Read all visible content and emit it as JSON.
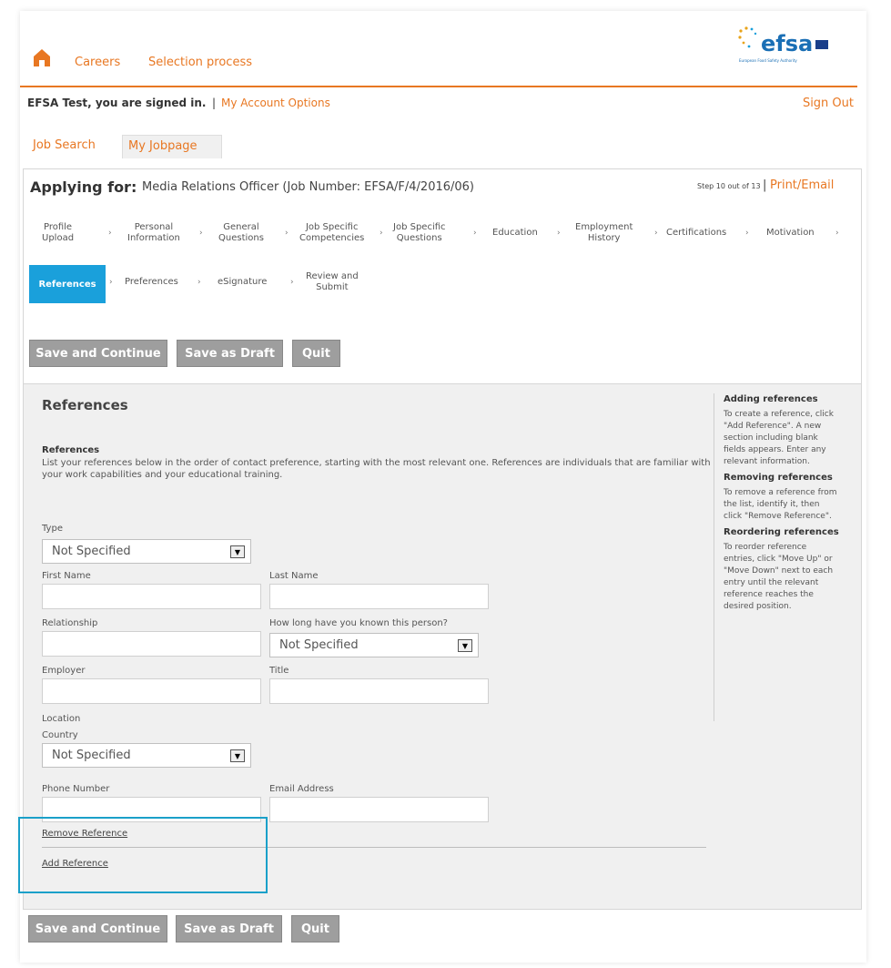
{
  "header": {
    "nav": [
      "Careers",
      "Selection process"
    ],
    "logo_text": "efsa",
    "logo_subtext": "European Food Safety Authority",
    "signed_in": "EFSA Test, you are signed in.",
    "separator": "|",
    "account_options": "My Account Options",
    "sign_out": "Sign Out"
  },
  "tabs": [
    "Job Search",
    "My Jobpage"
  ],
  "application": {
    "applying_for_label": "Applying for:",
    "job": "Media Relations Officer (Job Number: EFSA/F/4/2016/06)",
    "step": "Step 10 out of 13",
    "print_email": "Print/Email",
    "separator": "|"
  },
  "steps": [
    [
      "Profile",
      "Upload"
    ],
    [
      "Personal",
      "Information"
    ],
    [
      "General",
      "Questions"
    ],
    [
      "Job Specific",
      "Competencies"
    ],
    [
      "Job Specific",
      "Questions"
    ],
    [
      "Education"
    ],
    [
      "Employment",
      "History"
    ],
    [
      "Certifications"
    ],
    [
      "Motivation"
    ],
    [
      "References"
    ],
    [
      "Preferences"
    ],
    [
      "eSignature"
    ],
    [
      "Review and",
      "Submit"
    ]
  ],
  "step_sep": "›",
  "buttons": {
    "save_continue": "Save and Continue",
    "save_draft": "Save as Draft",
    "quit": "Quit"
  },
  "section": {
    "title": "References",
    "subtitle": "References",
    "description": "List your references below in the order of contact preference, starting with the most relevant one. References are individuals that are familiar with your work capabilities and your educational training."
  },
  "form": {
    "type_label": "Type",
    "type_value": "Not Specified",
    "first_name_label": "First Name",
    "last_name_label": "Last Name",
    "relationship_label": "Relationship",
    "known_label": "How long have you known this person?",
    "known_value": "Not Specified",
    "employer_label": "Employer",
    "title_label": "Title",
    "location_label": "Location",
    "country_label": "Country",
    "country_value": "Not Specified",
    "phone_label": "Phone Number",
    "email_label": "Email Address",
    "remove_link": "Remove Reference",
    "add_link": "Add Reference"
  },
  "help": {
    "adding_h": "Adding references",
    "adding_t": "To create a reference, click \"Add Reference\". A new section including blank fields appears. Enter any relevant information.",
    "removing_h": "Removing references",
    "removing_t": "To remove a reference from the list, identify it, then click \"Remove Reference\".",
    "reorder_h": "Reordering references",
    "reorder_t": "To reorder reference entries, click \"Move Up\" or \"Move Down\" next to each entry until the relevant reference reaches the desired position."
  },
  "colors": {
    "accent": "#e87722",
    "active_step": "#1aa0db",
    "button": "#9e9e9e"
  }
}
